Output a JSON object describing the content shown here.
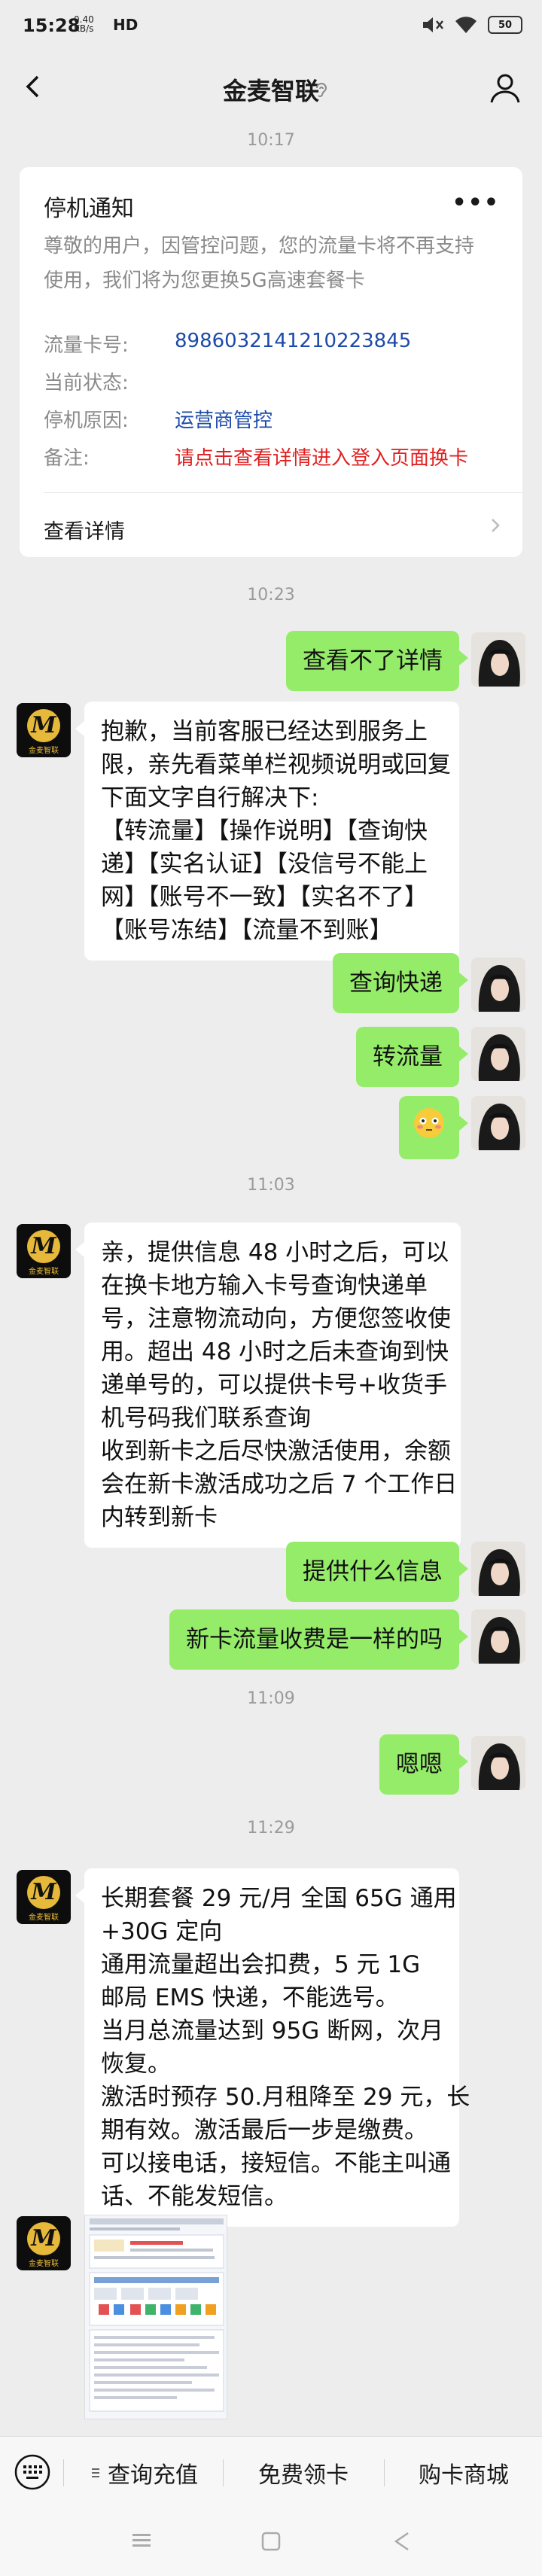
{
  "status_bar": {
    "time": "15:28",
    "net_top": "0.40",
    "net_bottom": "KB/s",
    "hd": "HD",
    "battery": "50"
  },
  "header": {
    "title": "金麦智联"
  },
  "timestamps": [
    "10:17",
    "10:23",
    "11:03",
    "11:09",
    "11:29"
  ],
  "notice": {
    "title": "停机通知",
    "more": "•••",
    "desc_lines": [
      "尊敬的用户，因管控问题，您的流量卡将不再支持",
      "使用，我们将为您更换5G高速套餐卡"
    ],
    "fields": [
      {
        "key": "流量卡号:",
        "value": "8986032141210223845"
      },
      {
        "key": "当前状态:",
        "value": ""
      },
      {
        "key": "停机原因:",
        "value": "运营商管控"
      },
      {
        "key": "备注:",
        "value": "请点击查看详情进入登入页面换卡"
      }
    ],
    "link": "查看详情"
  },
  "messages": {
    "m1": [
      "查看不了详情"
    ],
    "m2": [
      "抱歉，当前客服已经达到服务上",
      "限，亲先看菜单栏视频说明或回复",
      "下面文字自行解决下:",
      "【转流量】【操作说明】【查询快",
      "递】【实名认证】【没信号不能上",
      "网】【账号不一致】【实名不了】",
      "【账号冻结】【流量不到账】"
    ],
    "m3": [
      "查询快递"
    ],
    "m4": [
      "转流量"
    ],
    "m6": [
      "亲，提供信息 48 小时之后，可以",
      "在换卡地方输入卡号查询快递单",
      "号，注意物流动向，方便您签收使",
      "用。超出 48 小时之后未查询到快",
      "递单号的，可以提供卡号+收货手",
      "机号码我们联系查询",
      "收到新卡之后尽快激活使用，余额",
      "会在新卡激活成功之后 7 个工作日",
      "内转到新卡"
    ],
    "m7": [
      "提供什么信息"
    ],
    "m8": [
      "新卡流量收费是一样的吗"
    ],
    "m9": [
      "嗯嗯"
    ],
    "m10": [
      "长期套餐 29 元/月 全国 65G 通用",
      "+30G 定向",
      "通用流量超出会扣费，5 元 1G",
      "邮局 EMS 快递，不能选号。",
      "当月总流量达到 95G 断网，次月",
      "恢复。",
      "激活时预存 50.月租降至 29 元，长",
      "期有效。激活最后一步是缴费。",
      "可以接电话，接短信。不能主叫通",
      "话、不能发短信。"
    ]
  },
  "bot_avatar_text": "金麦智联",
  "bottom_menu": [
    "查询充值",
    "免费领卡",
    "购卡商城"
  ]
}
